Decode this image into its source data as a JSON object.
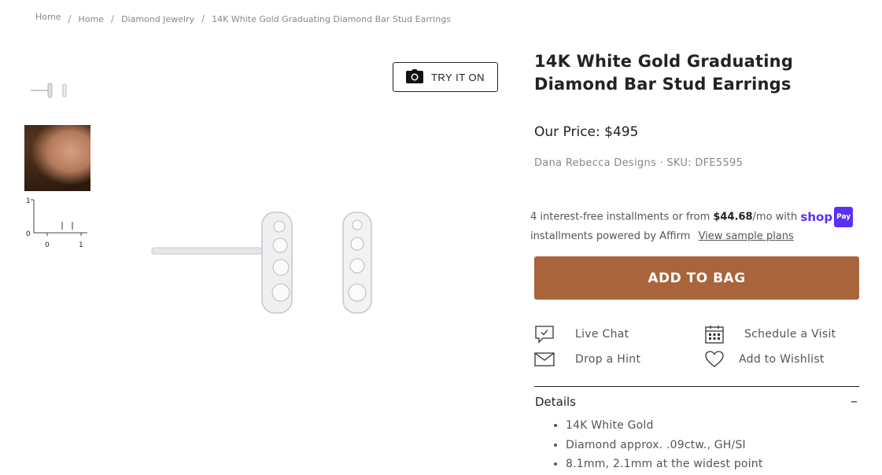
{
  "breadcrumb": {
    "items": [
      "Home",
      "Home",
      "Diamond Jewelry",
      "14K White Gold Graduating Diamond Bar Stud Earrings"
    ],
    "separator": "/"
  },
  "gallery": {
    "thumbnails": [
      "earrings-product-thumbnail",
      "model-wearing-earring-thumbnail",
      "earring-scale-ruler-thumbnail"
    ],
    "ruler_labels": {
      "y_top": "1",
      "y_bottom": "0",
      "x_left": "0",
      "x_right": "1"
    },
    "try_on_label": "TRY IT ON"
  },
  "product": {
    "title": "14K White Gold Graduating Diamond Bar Stud Earrings",
    "price_label": "Our Price:",
    "price": "$495",
    "brand_sku": "Dana Rebecca Designs · SKU: DFE5595"
  },
  "installments": {
    "prefix": "4 interest-free installments or from",
    "amount": "$44.68",
    "suffix": "/mo with",
    "shop_text": "shop",
    "pay_text": "Pay",
    "line2": "installments powered by Affirm",
    "link": "View sample plans"
  },
  "add_to_bag": "ADD TO BAG",
  "actions": {
    "live_chat": "Live Chat",
    "schedule": "Schedule a Visit",
    "hint": "Drop a Hint",
    "wishlist": "Add to Wishlist"
  },
  "details": {
    "heading": "Details",
    "toggle": "–",
    "items": [
      "14K White Gold",
      "Diamond approx. .09ctw., GH/SI",
      "8.1mm, 2.1mm at the widest point"
    ]
  },
  "colors": {
    "accent": "#a9643b",
    "shop_pay": "#5a31f4"
  }
}
